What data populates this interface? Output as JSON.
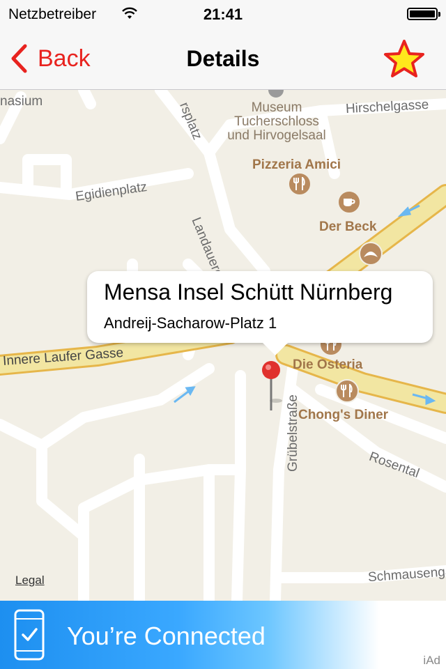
{
  "status_bar": {
    "carrier": "Netzbetreiber",
    "time": "21:41"
  },
  "nav": {
    "back_label": "Back",
    "title": "Details"
  },
  "callout": {
    "title": "Mensa Insel Schütt Nürnberg",
    "subtitle": "Andreij-Sacharow-Platz 1"
  },
  "map": {
    "streets": {
      "hirschelgasse": "Hirschelgasse",
      "egidienplatz": "Egidienplatz",
      "landauergasse": "Landauergasse",
      "innere_laufer_gasse": "Innere Laufer Gasse",
      "rosental": "Rosental",
      "gruebelstrasse": "Grübelstraße",
      "schmausengasse": "Schmausengasse",
      "rsplatz": "rsplatz",
      "nasium": "nasium"
    },
    "places": {
      "museum": "Museum\nTucherschloss\nund Hirvogelsaal"
    },
    "pois": {
      "pizzeria": "Pizzeria Amici",
      "der_beck": "Der Beck",
      "die_osteria": "Die Osteria",
      "chongs_diner": "Chong's Diner"
    },
    "legal_label": "Legal"
  },
  "ad": {
    "text": "You’re Connected",
    "badge": "iAd"
  },
  "colors": {
    "accent": "#e8231f",
    "star_fill": "#ffe81c",
    "pin": "#e0312d",
    "poi": "#b98b5f",
    "major_road": "#f2e6a2",
    "major_road_edge": "#e6b64a"
  },
  "icons": {
    "back": "chevron-left-icon",
    "favorite": "star-icon",
    "wifi": "wifi-icon",
    "battery": "battery-icon",
    "pin": "map-pin-icon",
    "restaurant": "fork-knife-icon",
    "cafe": "coffee-cup-icon",
    "bakery": "croissant-icon",
    "ad_phone": "phone-check-icon"
  }
}
